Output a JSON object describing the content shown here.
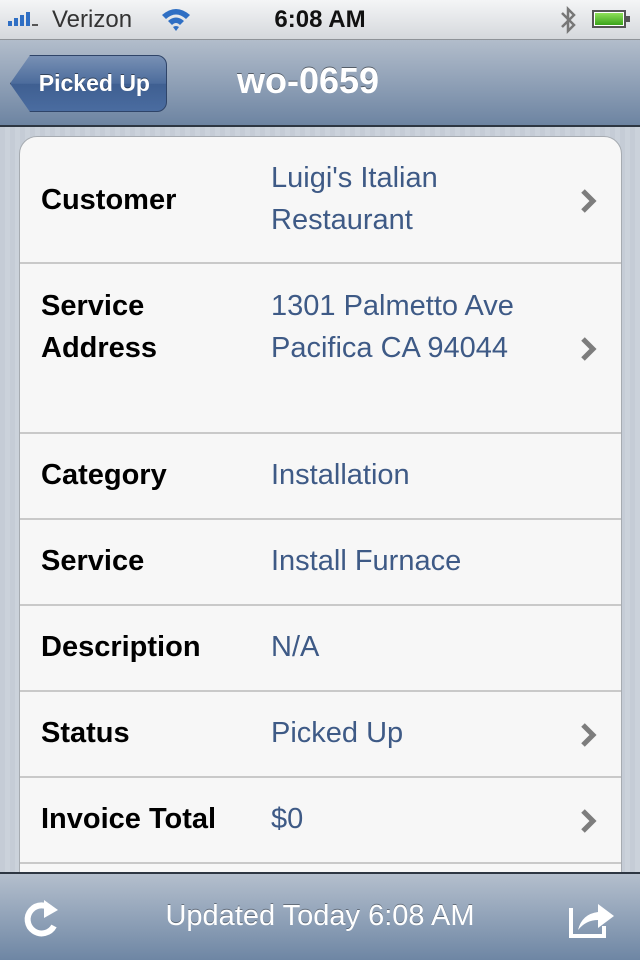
{
  "status_bar": {
    "carrier": "Verizon",
    "time": "6:08 AM",
    "icons": [
      "signal-icon",
      "wifi-icon",
      "bluetooth-icon",
      "battery-icon"
    ],
    "battery_level": 1.0
  },
  "nav": {
    "back_label": "Picked Up",
    "title": "wo-0659"
  },
  "details": {
    "rows": [
      {
        "label": "Customer",
        "value": "Luigi's Italian Restaurant",
        "value_lines": [
          "Luigi's Italian",
          "Restaurant"
        ],
        "disclosure": true
      },
      {
        "label": "Service Address",
        "label_lines": [
          "Service",
          "Address"
        ],
        "value_lines": [
          "1301 Palmetto Ave",
          "Pacifica CA 94044"
        ],
        "disclosure": true
      },
      {
        "label": "Category",
        "value": "Installation",
        "disclosure": false
      },
      {
        "label": "Service",
        "value": "Install Furnace",
        "disclosure": false
      },
      {
        "label": "Description",
        "value": "N/A",
        "disclosure": false
      },
      {
        "label": "Status",
        "value": "Picked Up",
        "disclosure": true
      },
      {
        "label": "Invoice Total",
        "value": "$0",
        "disclosure": true
      }
    ]
  },
  "toolbar": {
    "status_text": "Updated Today 6:08 AM",
    "left_icon": "refresh-icon",
    "right_icon": "share-icon"
  },
  "colors": {
    "value_text": "#3e5a86",
    "nav_gradient_top": "#b2bdcb",
    "nav_gradient_bottom": "#6d84a2",
    "back_button": "#4a6ca0"
  }
}
